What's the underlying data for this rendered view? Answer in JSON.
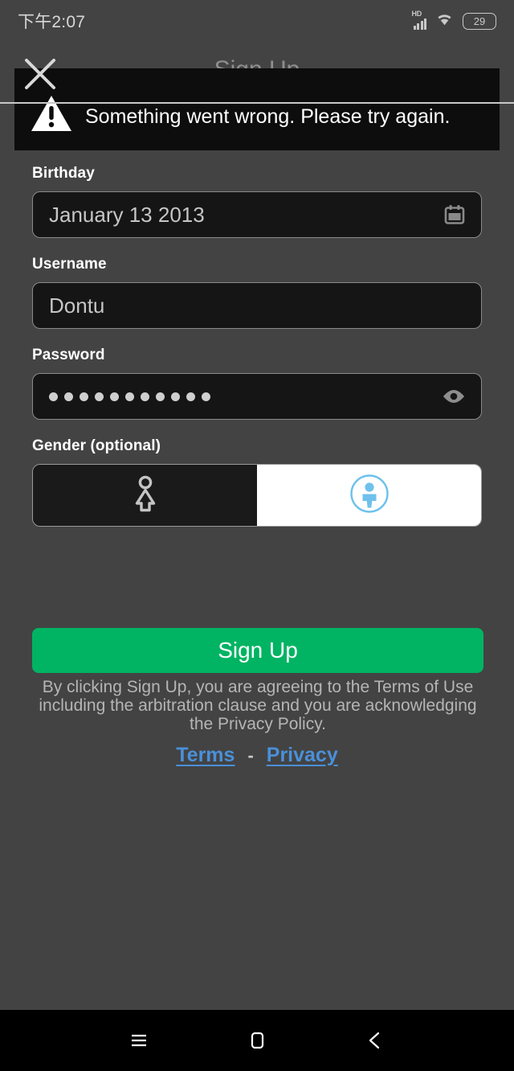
{
  "status_bar": {
    "clock": "下午2:07",
    "network_label": "HD",
    "signal_icon": "signal-bars-icon",
    "wifi_icon": "wifi-icon",
    "battery_level": "29"
  },
  "header": {
    "title": "Sign Up",
    "close_icon": "close-icon"
  },
  "toast": {
    "icon": "warning-triangle-icon",
    "message": "Something went wrong. Please try again."
  },
  "form": {
    "birthday": {
      "label": "Birthday",
      "value": "January 13 2013",
      "icon": "calendar-icon"
    },
    "username": {
      "label": "Username",
      "value": "Dontu"
    },
    "password": {
      "label": "Password",
      "masked_value": "•••••••••••",
      "dot_count": 11,
      "icon": "eye-icon"
    },
    "gender": {
      "label": "Gender (optional)",
      "options": [
        {
          "name": "female",
          "icon": "female-person-icon",
          "selected": false
        },
        {
          "name": "male",
          "icon": "male-person-circle-icon",
          "selected": true
        }
      ]
    }
  },
  "actions": {
    "signup_label": "Sign Up",
    "signup_color": "#00b463"
  },
  "legal": {
    "disclaimer": "By clicking Sign Up, you are agreeing to the Terms of Use including the arbitration clause and you are acknowledging the Privacy Policy.",
    "terms_label": "Terms",
    "separator": "-",
    "privacy_label": "Privacy",
    "link_color": "#4a90d9"
  },
  "nav_bar": {
    "recents_icon": "menu-icon",
    "home_icon": "home-square-icon",
    "back_icon": "back-chevron-icon"
  },
  "colors": {
    "background": "#434343",
    "field_background": "#151515",
    "toast_background": "#0d0d0d",
    "accent_green": "#00b463",
    "accent_blue": "#6ec1ec"
  }
}
